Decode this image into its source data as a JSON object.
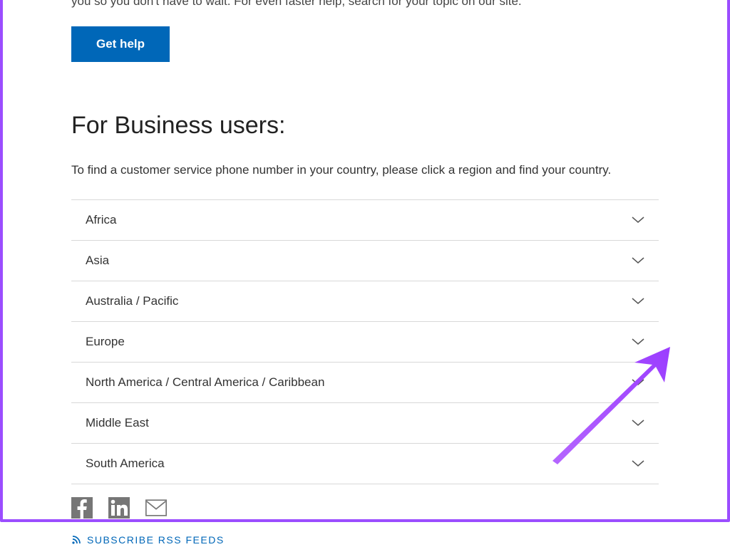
{
  "topText": "you so you don't have to wait. For even faster help, search for your topic on our site.",
  "getHelp": {
    "label": "Get help"
  },
  "businessSection": {
    "heading": "For Business users:",
    "description": "To find a customer service phone number in your country, please click a region and find your country.",
    "regions": [
      {
        "label": "Africa"
      },
      {
        "label": "Asia"
      },
      {
        "label": "Australia / Pacific"
      },
      {
        "label": "Europe"
      },
      {
        "label": "North America / Central America / Caribbean"
      },
      {
        "label": "Middle East"
      },
      {
        "label": "South America"
      }
    ]
  },
  "social": {
    "facebook": "facebook",
    "linkedin": "linkedin",
    "email": "email"
  },
  "rss": {
    "label": "SUBSCRIBE RSS FEEDS"
  }
}
